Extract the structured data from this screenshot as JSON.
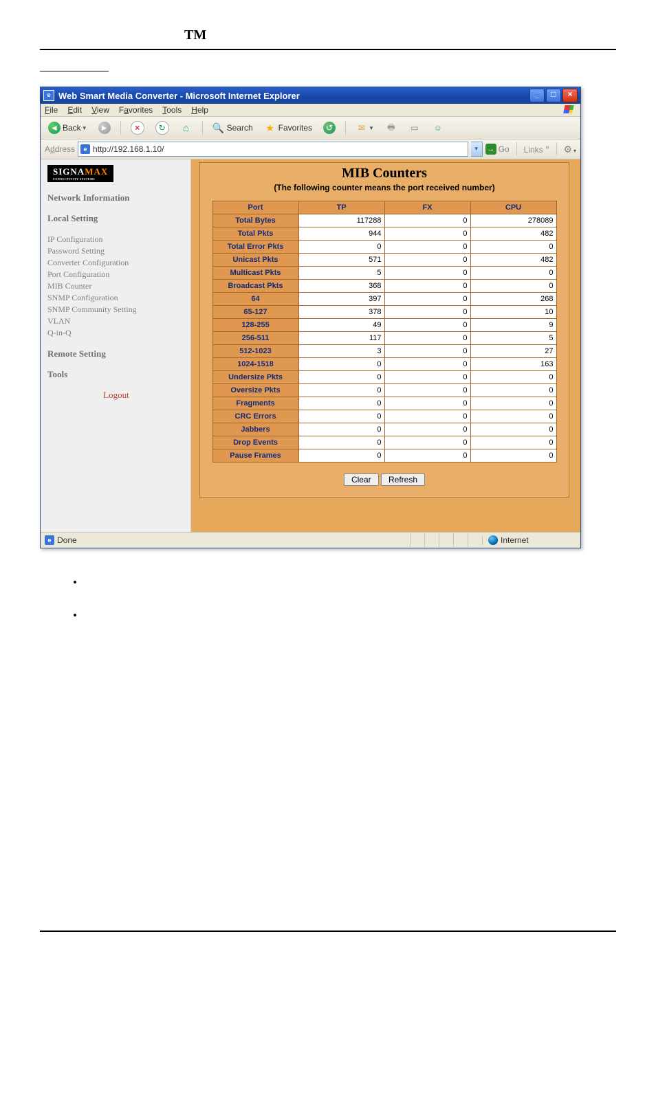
{
  "window": {
    "title": "Web Smart Media Converter - Microsoft Internet Explorer"
  },
  "menu": [
    "File",
    "Edit",
    "View",
    "Favorites",
    "Tools",
    "Help"
  ],
  "toolbar": {
    "back": "Back",
    "search": "Search",
    "favorites": "Favorites"
  },
  "address": {
    "label": "Address",
    "url": "http://192.168.1.10/",
    "go": "Go",
    "links": "Links"
  },
  "sidebar": {
    "logo1": "SIGNA",
    "logo2": "MAX",
    "logosub": "CONNECTIVITY SYSTEMS",
    "headNet": "Network Information",
    "headLocal": "Local Setting",
    "links": [
      "IP Configuration",
      "Password Setting",
      "Converter Configuration",
      "Port Configuration",
      "MIB Counter",
      "SNMP Configuration",
      "SNMP Community Setting",
      "VLAN",
      "Q-in-Q"
    ],
    "headRemote": "Remote Setting",
    "headTools": "Tools",
    "logout": "Logout"
  },
  "mib": {
    "title": "MIB Counters",
    "subtitle": "(The following counter means the port received number)",
    "cols": [
      "Port",
      "TP",
      "FX",
      "CPU"
    ],
    "rows": [
      {
        "label": "Total Bytes",
        "tp": "117288",
        "fx": "0",
        "cpu": "278089"
      },
      {
        "label": "Total Pkts",
        "tp": "944",
        "fx": "0",
        "cpu": "482"
      },
      {
        "label": "Total Error Pkts",
        "tp": "0",
        "fx": "0",
        "cpu": "0"
      },
      {
        "label": "Unicast Pkts",
        "tp": "571",
        "fx": "0",
        "cpu": "482"
      },
      {
        "label": "Multicast Pkts",
        "tp": "5",
        "fx": "0",
        "cpu": "0"
      },
      {
        "label": "Broadcast Pkts",
        "tp": "368",
        "fx": "0",
        "cpu": "0"
      },
      {
        "label": "64",
        "tp": "397",
        "fx": "0",
        "cpu": "268"
      },
      {
        "label": "65-127",
        "tp": "378",
        "fx": "0",
        "cpu": "10"
      },
      {
        "label": "128-255",
        "tp": "49",
        "fx": "0",
        "cpu": "9"
      },
      {
        "label": "256-511",
        "tp": "117",
        "fx": "0",
        "cpu": "5"
      },
      {
        "label": "512-1023",
        "tp": "3",
        "fx": "0",
        "cpu": "27"
      },
      {
        "label": "1024-1518",
        "tp": "0",
        "fx": "0",
        "cpu": "163"
      },
      {
        "label": "Undersize Pkts",
        "tp": "0",
        "fx": "0",
        "cpu": "0"
      },
      {
        "label": "Oversize Pkts",
        "tp": "0",
        "fx": "0",
        "cpu": "0"
      },
      {
        "label": "Fragments",
        "tp": "0",
        "fx": "0",
        "cpu": "0"
      },
      {
        "label": "CRC Errors",
        "tp": "0",
        "fx": "0",
        "cpu": "0"
      },
      {
        "label": "Jabbers",
        "tp": "0",
        "fx": "0",
        "cpu": "0"
      },
      {
        "label": "Drop Events",
        "tp": "0",
        "fx": "0",
        "cpu": "0"
      },
      {
        "label": "Pause Frames",
        "tp": "0",
        "fx": "0",
        "cpu": "0"
      }
    ],
    "btnClear": "Clear",
    "btnRefresh": "Refresh"
  },
  "status": {
    "done": "Done",
    "zone": "Internet"
  },
  "page": {
    "tm": "TM"
  }
}
